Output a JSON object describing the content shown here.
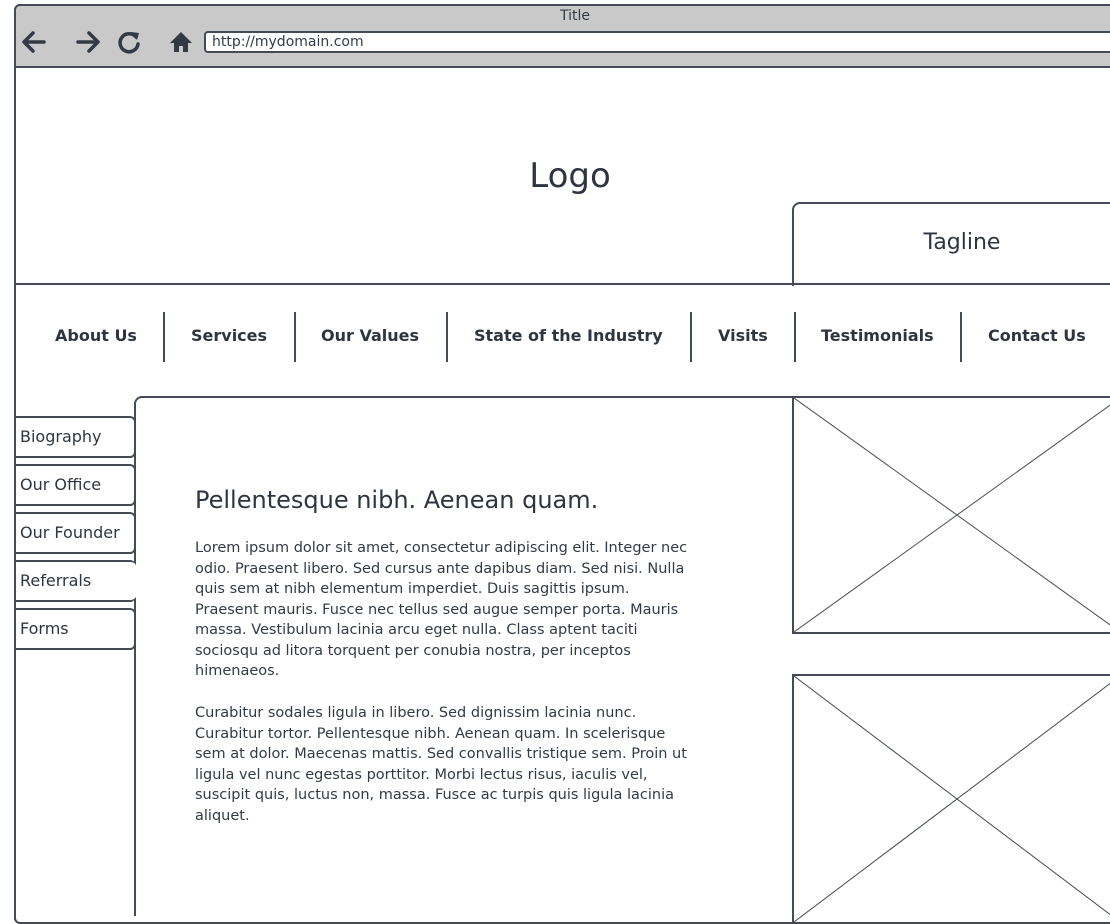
{
  "browser": {
    "title": "Title",
    "url": "http://mydomain.com",
    "icons": [
      "back-arrow-icon",
      "forward-arrow-icon",
      "reload-icon",
      "home-icon"
    ]
  },
  "header": {
    "logo": "Logo",
    "tagline": "Tagline"
  },
  "nav": {
    "items": [
      "About Us",
      "Services",
      "Our Values",
      "State of the Industry",
      "Visits",
      "Testimonials",
      "Contact Us"
    ]
  },
  "sidebar": {
    "tabs": [
      "Biography",
      "Our Office",
      "Our Founder",
      "Referrals",
      "Forms"
    ],
    "active": "Referrals"
  },
  "content": {
    "title": "Pellentesque nibh. Aenean quam.",
    "paragraphs": [
      "Lorem ipsum dolor sit amet, consectetur adipiscing elit. Integer nec odio. Praesent libero. Sed cursus ante dapibus diam. Sed nisi. Nulla quis sem at nibh elementum imperdiet. Duis sagittis ipsum. Praesent mauris. Fusce nec tellus sed augue semper porta. Mauris massa. Vestibulum lacinia arcu eget nulla. Class aptent taciti sociosqu ad litora torquent per conubia nostra, per inceptos himenaeos.",
      "Curabitur sodales ligula in libero. Sed dignissim lacinia nunc. Curabitur tortor. Pellentesque nibh. Aenean quam. In scelerisque sem at dolor. Maecenas mattis. Sed convallis tristique sem. Proin ut ligula vel nunc egestas porttitor. Morbi lectus risus, iaculis vel, suscipit quis, luctus non, massa. Fusce ac turpis quis ligula lacinia aliquet."
    ]
  },
  "colors": {
    "stroke": "#454b54",
    "chrome": "#c9c9c9",
    "text": "#333a46"
  }
}
